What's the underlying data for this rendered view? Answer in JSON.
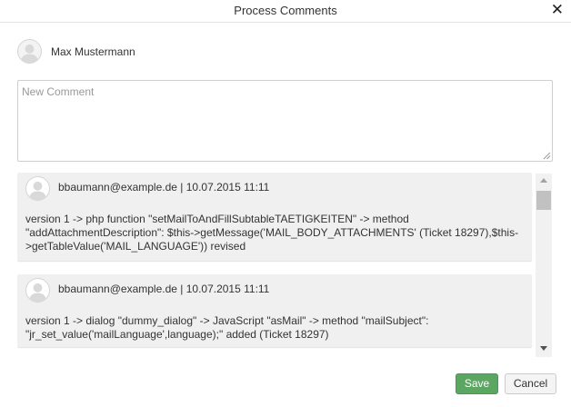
{
  "dialog": {
    "title": "Process Comments",
    "close_icon": "close-icon"
  },
  "current_user": {
    "name": "Max Mustermann"
  },
  "new_comment": {
    "placeholder": "New Comment",
    "value": ""
  },
  "comments": [
    {
      "meta": "bbaumann@example.de | 10.07.2015 11:11",
      "text": "version 1 -> php function \"setMailToAndFillSubtableTAETIGKEITEN\" -> method \"addAttachmentDescription\": $this->getMessage('MAIL_BODY_ATTACHMENTS' (Ticket 18297),$this->getTableValue('MAIL_LANGUAGE')) revised"
    },
    {
      "meta": "bbaumann@example.de | 10.07.2015 11:11",
      "text": "version 1 -> dialog \"dummy_dialog\" -> JavaScript \"asMail\" -> method \"mailSubject\": \"jr_set_value('mailLanguage',language);\" added (Ticket 18297)"
    }
  ],
  "buttons": {
    "save": "Save",
    "cancel": "Cancel"
  },
  "colors": {
    "save_button": "#5ba660",
    "card_background": "#f0f0f0"
  }
}
